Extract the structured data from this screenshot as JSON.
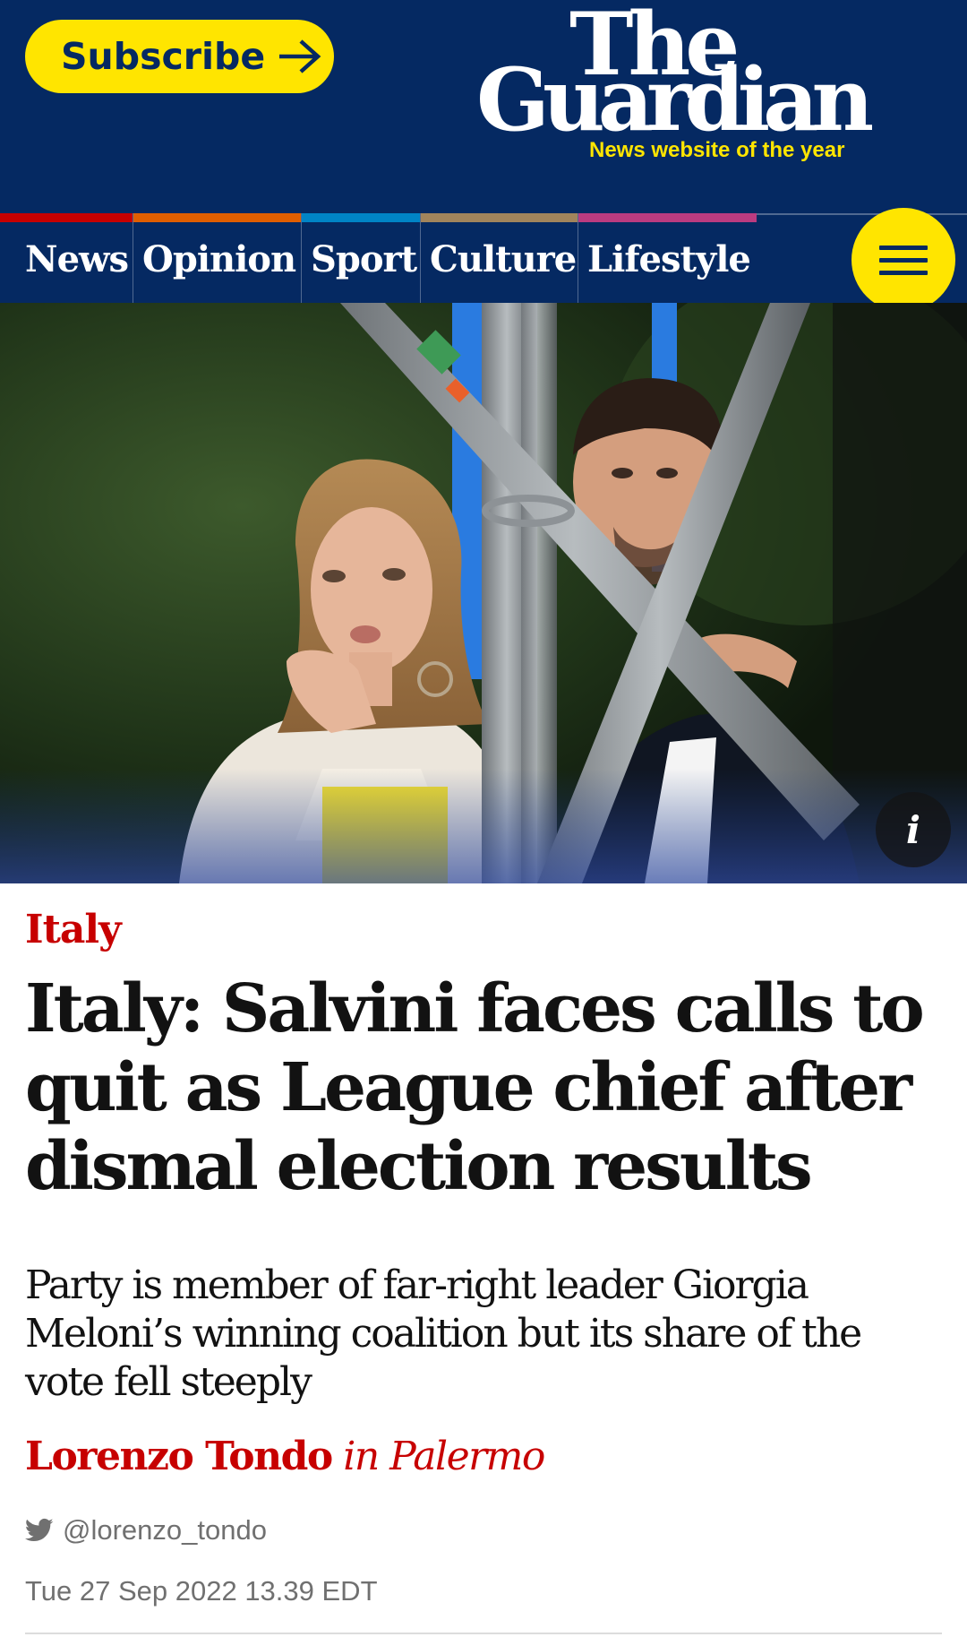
{
  "header": {
    "subscribe_label": "Subscribe",
    "logo_the": "The",
    "logo_guardian": "Guardian",
    "tagline": "News website of the year",
    "colors": {
      "brand_blue": "#052962",
      "accent_yellow": "#ffe500"
    }
  },
  "nav": {
    "items": [
      {
        "label": "News",
        "color": "#c70000"
      },
      {
        "label": "Opinion",
        "color": "#e05e00"
      },
      {
        "label": "Sport",
        "color": "#0084c6"
      },
      {
        "label": "Culture",
        "color": "#a1845c"
      },
      {
        "label": "Lifestyle",
        "color": "#bb3b80"
      }
    ],
    "menu_icon": "hamburger-icon"
  },
  "photo": {
    "info_label": "i"
  },
  "article": {
    "kicker": "Italy",
    "headline": "Italy: Salvini faces calls to quit as League chief after dismal election results",
    "standfirst": "Party is member of far-right leader Giorgia Meloni’s winning coalition but its share of the vote fell steeply",
    "author": "Lorenzo Tondo",
    "location": "in Palermo",
    "twitter_handle": "@lorenzo_tondo",
    "date": "Tue 27 Sep 2022 13.39 EDT",
    "accent_color": "#c70000"
  }
}
